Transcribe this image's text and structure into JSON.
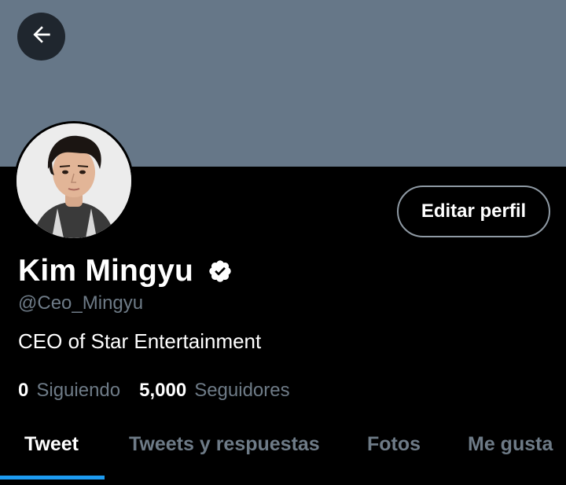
{
  "header": {
    "back_icon": "arrow-left-icon",
    "banner_color": "#667788"
  },
  "profile": {
    "avatar_icon": "profile-photo",
    "edit_button_label": "Editar perfil",
    "display_name": "Kim Mingyu",
    "verified_icon": "verified-badge-icon",
    "handle": "@Ceo_Mingyu",
    "bio": "CEO of Star Entertainment"
  },
  "stats": {
    "following_count": "0",
    "following_label": "Siguiendo",
    "followers_count": "5,000",
    "followers_label": "Seguidores"
  },
  "tabs": [
    {
      "label": "Tweet",
      "active": true
    },
    {
      "label": "Tweets y respuestas",
      "active": false
    },
    {
      "label": "Fotos",
      "active": false
    },
    {
      "label": "Me gusta",
      "active": false
    }
  ],
  "colors": {
    "background": "#000000",
    "accent": "#1d9bf0",
    "muted_text": "#6e7b87"
  }
}
